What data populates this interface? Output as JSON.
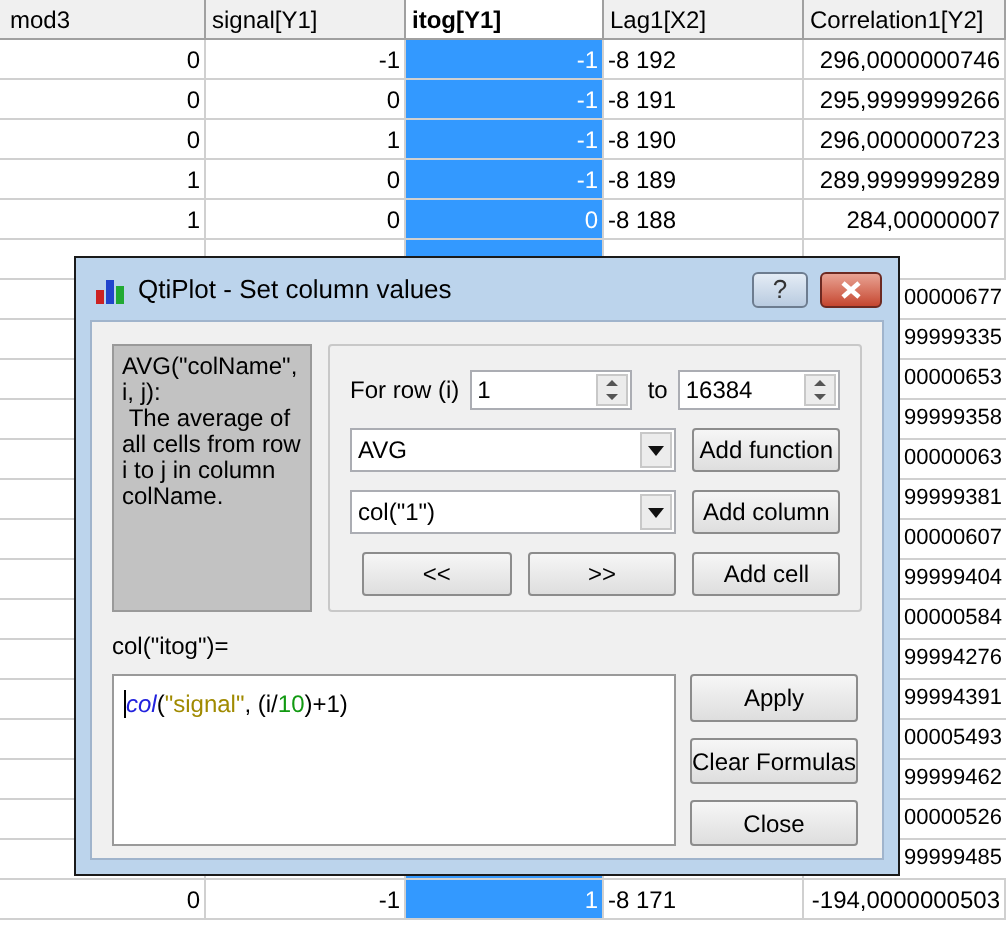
{
  "table": {
    "columns": [
      {
        "label": "mod3",
        "selected": false
      },
      {
        "label": "signal[Y1]",
        "selected": false
      },
      {
        "label": "itog[Y1]",
        "selected": true
      },
      {
        "label": "Lag1[X2]",
        "selected": false
      },
      {
        "label": "Correlation1[Y2]",
        "selected": false
      }
    ],
    "rows_above": [
      [
        "0",
        "-1",
        "-1",
        "-8 192",
        "296,0000000746"
      ],
      [
        "0",
        "0",
        "-1",
        "-8 191",
        "295,9999999266"
      ],
      [
        "0",
        "1",
        "-1",
        "-8 190",
        "296,0000000723"
      ],
      [
        "1",
        "0",
        "-1",
        "-8 189",
        "289,9999999289"
      ],
      [
        "1",
        "0",
        "0",
        "-8 188",
        "284,00000007"
      ]
    ],
    "covered_rows": [
      "00000677",
      "99999335",
      "00000653",
      "99999358",
      "00000063",
      "99999381",
      "00000607",
      "99999404",
      "00000584",
      "99994276",
      "99994391",
      "00005493",
      "99999462",
      "00000526",
      "99999485"
    ],
    "rows_below": [
      [
        "0",
        "-1",
        "1",
        "-8 171",
        "-194,0000000503"
      ]
    ]
  },
  "dialog": {
    "title": "QtiPlot - Set column values",
    "help_button": "?",
    "description": "AVG(\"colName\", i, j):\n The average of all cells from row i to j in column colName.",
    "row_from_label": "For row (i)",
    "row_from": "1",
    "row_to_label": "to",
    "row_to": "16384",
    "function_combo": "AVG",
    "add_function": "Add function",
    "column_combo": "col(\"1\")",
    "add_column": "Add column",
    "prev_button": "<<",
    "next_button": ">>",
    "add_cell": "Add cell",
    "formula_label": "col(\"itog\")=",
    "formula_tokens": [
      {
        "text": "col",
        "kind": "function"
      },
      {
        "text": "(",
        "kind": "plain"
      },
      {
        "text": "\"signal\"",
        "kind": "string"
      },
      {
        "text": ", (i/",
        "kind": "plain"
      },
      {
        "text": "10",
        "kind": "number"
      },
      {
        "text": ")+1)",
        "kind": "plain"
      }
    ],
    "buttons": [
      "Apply",
      "Clear Formulas",
      "Close"
    ]
  }
}
